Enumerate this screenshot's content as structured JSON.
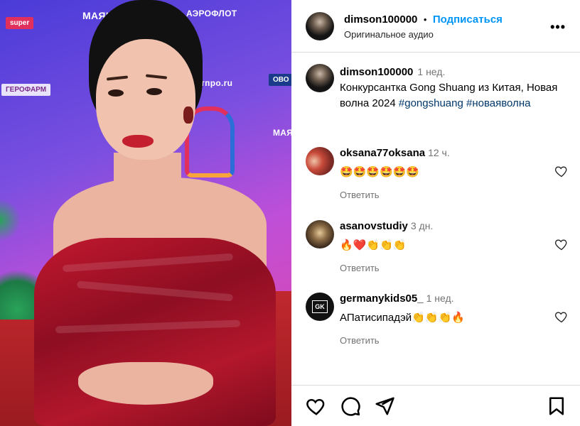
{
  "media": {
    "sponsors": [
      "super",
      "ГЕРОФАРМ",
      "АЭРОФЛОТ",
      "МАЯК",
      "ОВО",
      "тпро.ru",
      "МАЯК"
    ]
  },
  "post": {
    "author": "dimson100000",
    "separator": "•",
    "follow_label": "Подписаться",
    "audio_label": "Оригинальное аудио",
    "more_label": "•••",
    "caption": {
      "username": "dimson100000",
      "time": "1 нед.",
      "text": "Конкурсантка Gong Shuang из Китая, Новая волна 2024 ",
      "tag1": "#gongshuang",
      "tag2": "#новаяволна"
    }
  },
  "comments": [
    {
      "username": "oksana77oksana",
      "time": "12 ч.",
      "text": "🤩🤩🤩🤩🤩🤩",
      "reply": "Ответить"
    },
    {
      "username": "asanovstudiy",
      "time": "3 дн.",
      "text": "🔥❤️👏👏👏",
      "reply": "Ответить"
    },
    {
      "username": "germanykids05_",
      "time": "1 нед.",
      "text": "АПатисипадэй👏👏👏🔥",
      "reply": "Ответить",
      "avatar_text": "GK"
    }
  ],
  "colors": {
    "link": "#0095f6",
    "hashtag": "#00376b",
    "muted": "#737373",
    "dress": "#b3172c"
  }
}
